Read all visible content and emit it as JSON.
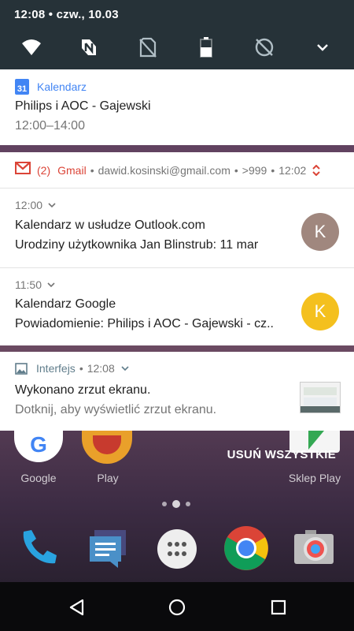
{
  "status_bar": {
    "time": "12:08",
    "date": "czw., 10.03"
  },
  "quick_settings": {
    "icons": [
      "wifi-icon",
      "nfc-icon",
      "no-sim-icon",
      "battery-icon",
      "data-saver-icon",
      "expand-icon"
    ]
  },
  "calendar_notification": {
    "app_name": "Kalendarz",
    "icon_day": "31",
    "title": "Philips i AOC - Gajewski",
    "time_range": "12:00–14:00"
  },
  "gmail_notification": {
    "count": "(2)",
    "app_name": "Gmail",
    "account": "dawid.kosinski@gmail.com",
    "unread": ">999",
    "time": "12:02",
    "messages": [
      {
        "time": "12:00",
        "sender": "Kalendarz w usłudze Outlook.com",
        "preview": "Urodziny użytkownika Jan Blinstrub: 11 mar",
        "avatar_letter": "K",
        "avatar_color": "#a0877e"
      },
      {
        "time": "11:50",
        "sender": "Kalendarz Google",
        "preview": "Powiadomienie: Philips i AOC - Gajewski - cz..",
        "avatar_letter": "K",
        "avatar_color": "#f4c01e"
      }
    ]
  },
  "screenshot_notification": {
    "app_name": "Interfejs",
    "time": "12:08",
    "title": "Wykonano zrzut ekranu.",
    "subtitle": "Dotknij, aby wyświetlić zrzut ekranu."
  },
  "clear_all": "USUŃ WSZYSTKIE",
  "home_screen": {
    "apps": [
      "Google",
      "Play",
      "Sklep Play"
    ]
  },
  "colors": {
    "calendar_blue": "#4285f4",
    "gmail_red": "#db4437",
    "system_blue": "#607d8b"
  }
}
